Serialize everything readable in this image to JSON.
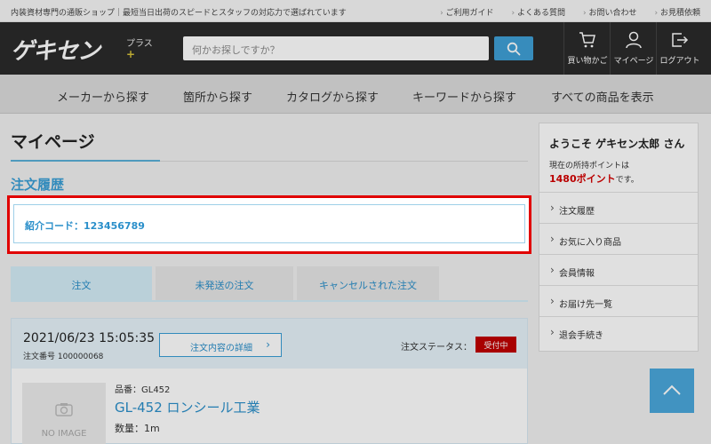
{
  "topbar": {
    "tagline": "内装資材専門の通販ショップ｜最短当日出荷のスピードとスタッフの対応力で選ばれています",
    "links": [
      "ご利用ガイド",
      "よくある質問",
      "お問い合わせ",
      "お見積依頼"
    ]
  },
  "header": {
    "logo_main": "ゲキセン",
    "logo_plus": "プラス",
    "logo_plus_mark": "+",
    "search_placeholder": "何かお探しですか？",
    "icons": [
      {
        "name": "cart-icon",
        "label": "買い物かご"
      },
      {
        "name": "user-icon",
        "label": "マイページ"
      },
      {
        "name": "logout-icon",
        "label": "ログアウト"
      }
    ]
  },
  "nav": {
    "items": [
      "メーカーから探す",
      "箇所から探す",
      "カタログから探す",
      "キーワードから探す",
      "すべての商品を表示"
    ]
  },
  "main": {
    "page_title": "マイページ",
    "section_title": "注文履歴",
    "referral_code": "紹介コード：123456789",
    "tabs": [
      {
        "label": "注文",
        "active": true
      },
      {
        "label": "未発送の注文",
        "active": false
      },
      {
        "label": "キャンセルされた注文",
        "active": false
      }
    ],
    "order": {
      "date": "2021/06/23 15:05:35",
      "number": "注文番号 100000068",
      "detail_button": "注文内容の詳細",
      "status_label": "注文ステータス：",
      "status": "受付中",
      "status_color": "#c00000",
      "no_image": "NO IMAGE",
      "product_code": "品番：GL452",
      "product_name": "GL-452 ロンシール工業",
      "quantity": "数量：1m"
    }
  },
  "sidebar": {
    "welcome": "ようこそ ゲキセン太郎 さん",
    "points_prefix": "現在の所持ポイントは",
    "points_value": "1480ポイント",
    "points_suffix": "です。",
    "menu": [
      "注文履歴",
      "お気に入り商品",
      "会員情報",
      "お届け先一覧",
      "退会手続き"
    ]
  },
  "colors": {
    "accent": "#3a9fd6",
    "header_bg": "#2b2b2b",
    "highlight_border": "#e00000",
    "points": "#d40000"
  }
}
